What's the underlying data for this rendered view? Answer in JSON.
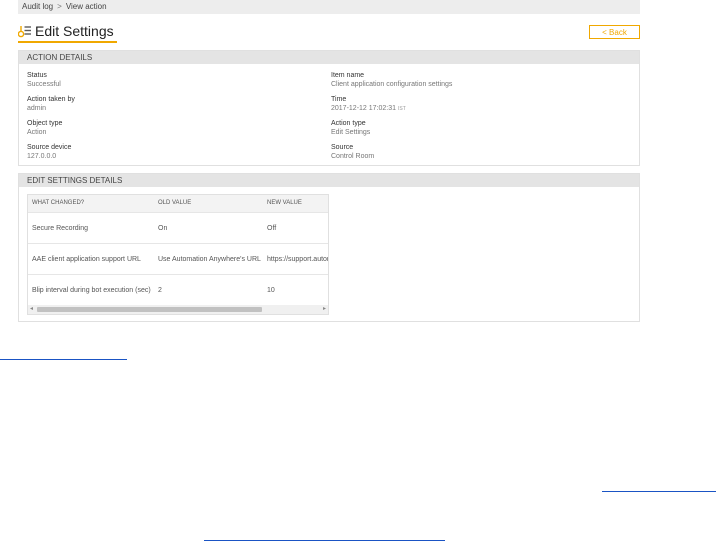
{
  "breadcrumb": {
    "parent": "Audit log",
    "separator": ">",
    "current": "View action"
  },
  "page": {
    "title": "Edit Settings",
    "back_label": "< Back",
    "title_icon": "edit-settings-icon"
  },
  "action_details": {
    "header": "ACTION DETAILS",
    "status_label": "Status",
    "status_value": "Successful",
    "item_name_label": "Item name",
    "item_name_value": "Client application configuration settings",
    "action_taken_by_label": "Action taken by",
    "action_taken_by_value": "admin",
    "time_label": "Time",
    "time_value": "2017-12-12 17:02:31",
    "time_zone": "IST",
    "object_type_label": "Object type",
    "object_type_value": "Action",
    "action_type_label": "Action type",
    "action_type_value": "Edit Settings",
    "source_device_label": "Source device",
    "source_device_value": "127.0.0.0",
    "source_label": "Source",
    "source_value": "Control Room"
  },
  "edit_settings_details": {
    "header": "EDIT SETTINGS DETAILS",
    "columns": [
      "WHAT CHANGED?",
      "OLD VALUE",
      "NEW VALUE"
    ],
    "rows": [
      [
        "Secure Recording",
        "On",
        "Off"
      ],
      [
        "AAE client application support URL",
        "Use Automation Anywhere's URL",
        "https://support.automationanywhere.com"
      ],
      [
        "Blip interval during bot execution (sec)",
        "2",
        "10"
      ]
    ]
  },
  "colors": {
    "accent": "#f0a800",
    "link": "#1a54c4",
    "header_bg": "#e4e4e4"
  }
}
